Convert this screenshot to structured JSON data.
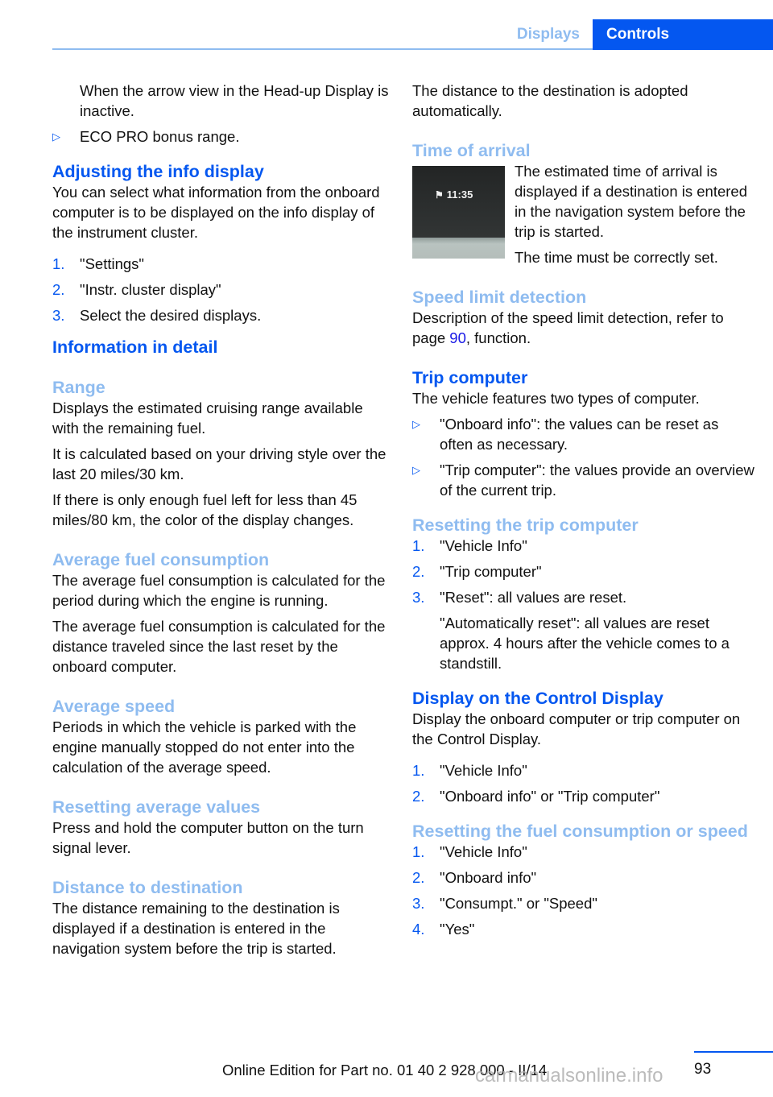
{
  "header": {
    "tabs": [
      {
        "label": "Displays",
        "active": false
      },
      {
        "label": "Controls",
        "active": true
      }
    ],
    "colors": {
      "accent": "#0457f0",
      "light_accent": "#8fbcf0"
    }
  },
  "left": {
    "intro_cont": "When the arrow view in the Head-up Display is inactive.",
    "intro_bullet": "ECO PRO bonus range.",
    "adjust": {
      "title": "Adjusting the info display",
      "text": "You can select what information from the onboard computer is to be displayed on the info display of the instrument cluster.",
      "steps": [
        {
          "num": "1.",
          "text": "\"Settings\""
        },
        {
          "num": "2.",
          "text": "\"Instr. cluster display\""
        },
        {
          "num": "3.",
          "text": "Select the desired displays."
        }
      ]
    },
    "detail_title": "Information in detail",
    "range": {
      "title": "Range",
      "p1": "Displays the estimated cruising range available with the remaining fuel.",
      "p2": "It is calculated based on your driving style over the last 20 miles/30 km.",
      "p3": "If there is only enough fuel left for less than 45 miles/80 km, the color of the display changes."
    },
    "avg_fuel": {
      "title": "Average fuel consumption",
      "p1": "The average fuel consumption is calculated for the period during which the engine is running.",
      "p2": "The average fuel consumption is calculated for the distance traveled since the last reset by the onboard computer."
    },
    "avg_speed": {
      "title": "Average speed",
      "p1": "Periods in which the vehicle is parked with the engine manually stopped do not enter into the calculation of the average speed."
    },
    "reset_avg": {
      "title": "Resetting average values",
      "p1": "Press and hold the computer button on the turn signal lever."
    },
    "dist_dest": {
      "title": "Distance to destination",
      "p1": "The distance remaining to the destination is displayed if a destination is entered in the navigation system before the trip is started."
    }
  },
  "right": {
    "dist_cont": "The distance to the destination is adopted automatically.",
    "arrival": {
      "title": "Time of arrival",
      "image_time": "11:35",
      "image_icon": "destination-flag-icon",
      "p1": "The estimated time of arrival is displayed if a destination is entered in the navigation system before the trip is started.",
      "p2": "The time must be correctly set."
    },
    "speed_limit": {
      "title": "Speed limit detection",
      "text_before": "Description of the speed limit detection, refer to page ",
      "page_link": "90",
      "text_after": ", function."
    },
    "trip": {
      "title": "Trip computer",
      "p1": "The vehicle features two types of computer.",
      "bullets": [
        "\"Onboard info\": the values can be reset as often as necessary.",
        "\"Trip computer\": the values provide an overview of the current trip."
      ]
    },
    "reset_trip": {
      "title": "Resetting the trip computer",
      "steps": [
        {
          "num": "1.",
          "text": "\"Vehicle Info\""
        },
        {
          "num": "2.",
          "text": "\"Trip computer\""
        },
        {
          "num": "3.",
          "text": "\"Reset\": all values are reset."
        }
      ],
      "note": "\"Automatically reset\": all values are reset approx. 4 hours after the vehicle comes to a standstill."
    },
    "control_display": {
      "title": "Display on the Control Display",
      "p1": "Display the onboard computer or trip computer on the Control Display.",
      "steps": [
        {
          "num": "1.",
          "text": "\"Vehicle Info\""
        },
        {
          "num": "2.",
          "text": "\"Onboard info\" or \"Trip computer\""
        }
      ]
    },
    "reset_fuel": {
      "title": "Resetting the fuel consumption or speed",
      "steps": [
        {
          "num": "1.",
          "text": "\"Vehicle Info\""
        },
        {
          "num": "2.",
          "text": "\"Onboard info\""
        },
        {
          "num": "3.",
          "text": "\"Consumpt.\" or \"Speed\""
        },
        {
          "num": "4.",
          "text": "\"Yes\""
        }
      ]
    }
  },
  "footer": {
    "page_number": "93",
    "edition": "Online Edition for Part no. 01 40 2 928 000 - II/14",
    "watermark": "carmanualsonline.info"
  }
}
